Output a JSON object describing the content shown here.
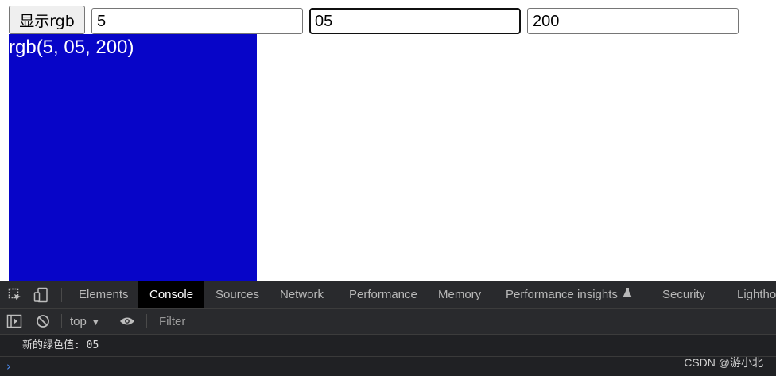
{
  "controls": {
    "show_button_label": "显示rgb",
    "red_value": "5",
    "green_value": "05",
    "blue_value": "200"
  },
  "preview": {
    "label": "rgb(5, 05, 200)",
    "background_color": "#0705c8"
  },
  "devtools": {
    "tabs": [
      {
        "label": "Elements"
      },
      {
        "label": "Console"
      },
      {
        "label": "Sources"
      },
      {
        "label": "Network"
      },
      {
        "label": "Performance"
      },
      {
        "label": "Memory"
      },
      {
        "label": "Performance insights"
      },
      {
        "label": "Security"
      },
      {
        "label": "Lighthouse"
      }
    ],
    "active_tab": "Console",
    "context_label": "top",
    "filter_placeholder": "Filter",
    "console_log": "新的绿色值: 05",
    "prompt_symbol": "›"
  },
  "watermark": "CSDN @游小北",
  "colors": {
    "devtools_bg": "#202124",
    "prompt_accent": "#4d8ff5"
  },
  "icons": [
    "inspect-element-icon",
    "device-toolbar-icon",
    "flask-icon",
    "sidebar-toggle-icon",
    "clear-console-icon",
    "eye-icon",
    "dropdown-caret-icon",
    "prompt-chevron-icon"
  ]
}
